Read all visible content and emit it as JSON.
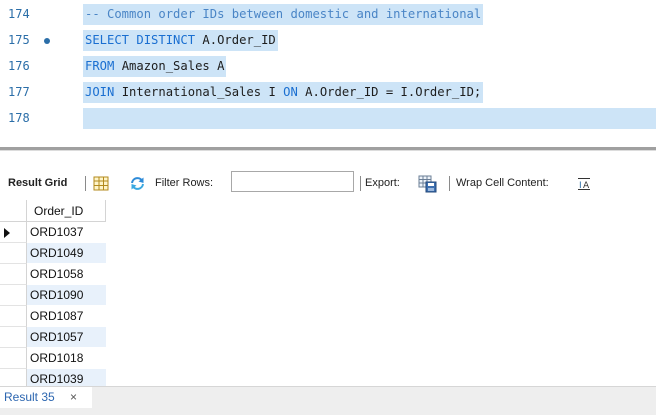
{
  "editor": {
    "lines": [
      {
        "num": "174",
        "breakpoint": false,
        "tokens": [
          {
            "t": "-- Common order IDs between domestic and international",
            "c": "cm"
          }
        ]
      },
      {
        "num": "175",
        "breakpoint": true,
        "tokens": [
          {
            "t": "SELECT DISTINCT",
            "c": "kw"
          },
          {
            "t": " A.Order_ID",
            "c": "id"
          }
        ]
      },
      {
        "num": "176",
        "breakpoint": false,
        "tokens": [
          {
            "t": "FROM",
            "c": "kw"
          },
          {
            "t": " Amazon_Sales A",
            "c": "id"
          }
        ]
      },
      {
        "num": "177",
        "breakpoint": false,
        "tokens": [
          {
            "t": "JOIN",
            "c": "kw"
          },
          {
            "t": " International_Sales I ",
            "c": "id"
          },
          {
            "t": "ON",
            "c": "kw"
          },
          {
            "t": " A.Order_ID = I.Order_ID;",
            "c": "id"
          }
        ]
      },
      {
        "num": "178",
        "breakpoint": false,
        "tokens": []
      }
    ]
  },
  "toolbar": {
    "result_grid_label": "Result Grid",
    "filter_rows_label": "Filter Rows:",
    "filter_value": "",
    "export_label": "Export:",
    "wrap_label": "Wrap Cell Content:"
  },
  "grid": {
    "column_header": "Order_ID",
    "rows": [
      "ORD1037",
      "ORD1049",
      "ORD1058",
      "ORD1090",
      "ORD1087",
      "ORD1057",
      "ORD1018",
      "ORD1039"
    ]
  },
  "tabs": {
    "result_tab_label": "Result 35",
    "close_glyph": "×"
  },
  "colors": {
    "keyword": "#1a6fd1",
    "selection": "#cde4f7",
    "line_number": "#2b6ea8"
  }
}
